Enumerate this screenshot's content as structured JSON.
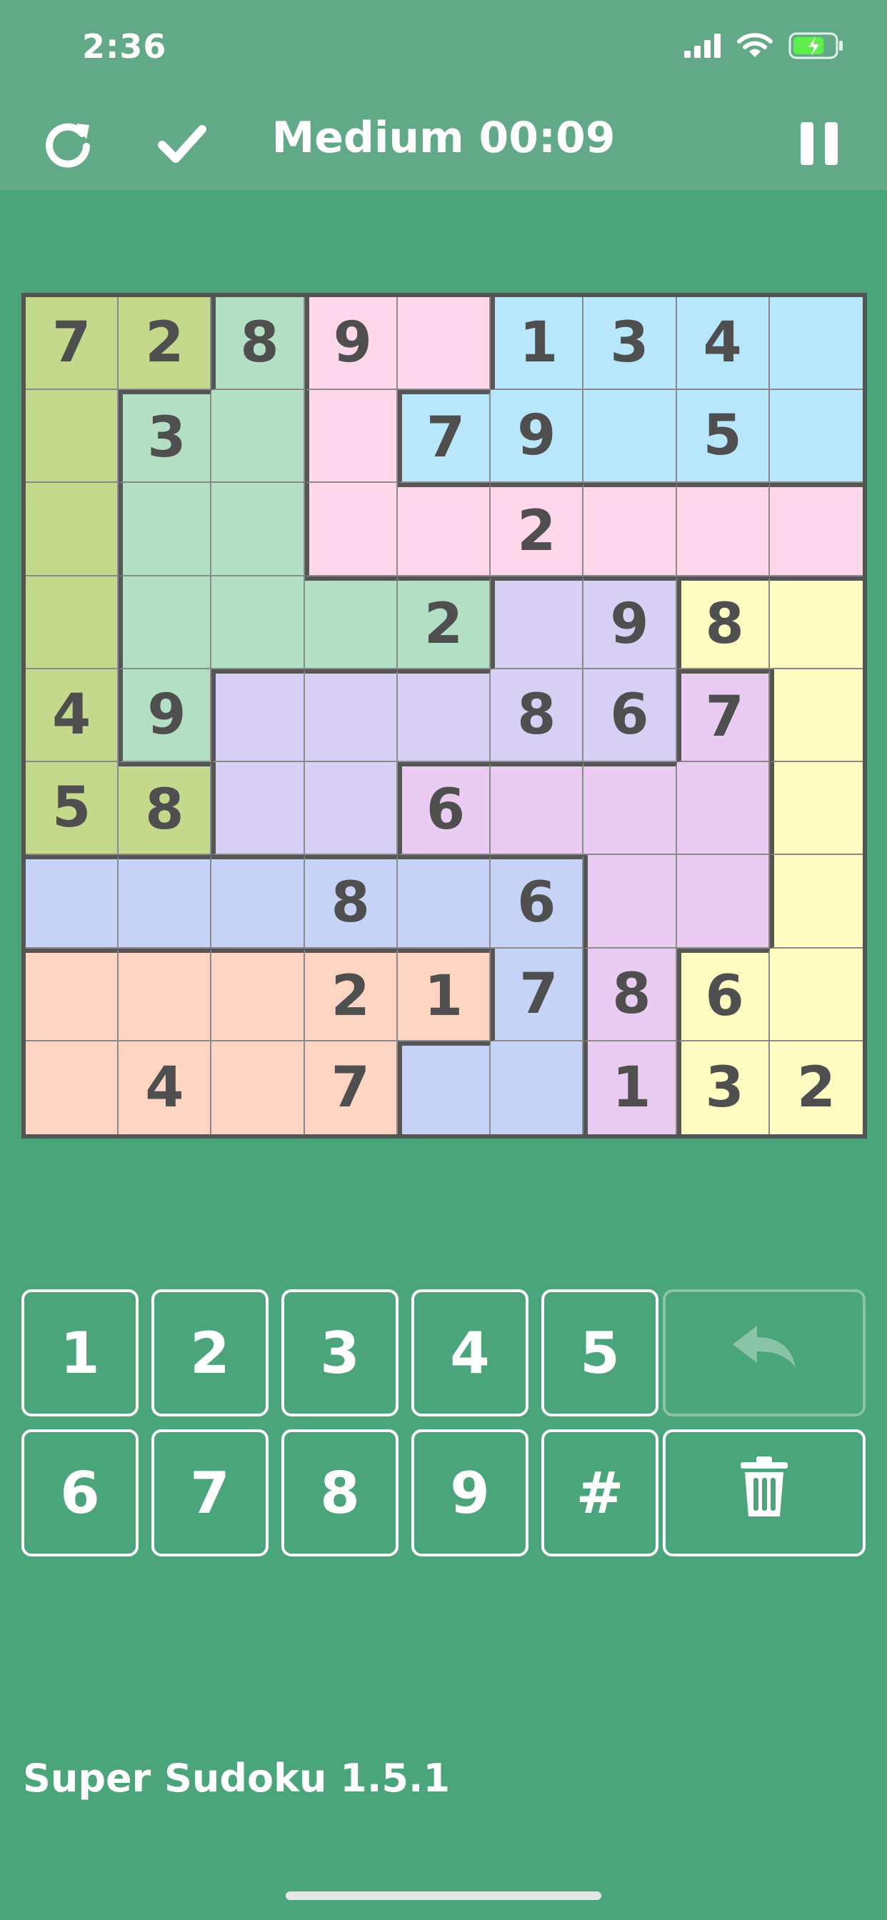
{
  "status": {
    "time": "2:36"
  },
  "toolbar": {
    "title": "Medium 00:09",
    "icons": [
      "refresh-icon",
      "check-icon",
      "pause-icon"
    ]
  },
  "colors": {
    "A": "#c5d98c",
    "B": "#b3e0c4",
    "C": "#fed8ea",
    "D": "#b8e6fa",
    "E": "#fefcc0",
    "F": "#d7d0f4",
    "G": "#eaccf3",
    "H": "#c6d2f6",
    "I": "#fed5c2"
  },
  "board": {
    "regions": [
      "AABCCDDDD",
      "ABBCDDDDD",
      "ABBCCCCCC",
      "ABBBBFFEE",
      "ABFFFFFGE",
      "AAFFGGGGE",
      "HHHHHHGGE",
      "IIIIIHGEE",
      "IIIIHHGEE"
    ],
    "values": [
      [
        "7",
        "2",
        "8",
        "9",
        "",
        "1",
        "3",
        "4",
        ""
      ],
      [
        "",
        "3",
        "",
        "",
        "7",
        "9",
        "",
        "5",
        ""
      ],
      [
        "",
        "",
        "",
        "",
        "",
        "2",
        "",
        "",
        ""
      ],
      [
        "",
        "",
        "",
        "",
        "2",
        "",
        "9",
        "8",
        ""
      ],
      [
        "4",
        "9",
        "",
        "",
        "",
        "8",
        "6",
        "7",
        ""
      ],
      [
        "5",
        "8",
        "",
        "",
        "6",
        "",
        "",
        "",
        ""
      ],
      [
        "",
        "",
        "",
        "8",
        "",
        "6",
        "",
        "",
        ""
      ],
      [
        "",
        "",
        "",
        "2",
        "1",
        "7",
        "8",
        "6",
        ""
      ],
      [
        "",
        "4",
        "",
        "7",
        "",
        "",
        "1",
        "3",
        "2"
      ]
    ]
  },
  "keypad": {
    "row1": [
      "1",
      "2",
      "3",
      "4",
      "5"
    ],
    "row2": [
      "6",
      "7",
      "8",
      "9",
      "#"
    ]
  },
  "footer": {
    "label": "Super Sudoku 1.5.1"
  }
}
